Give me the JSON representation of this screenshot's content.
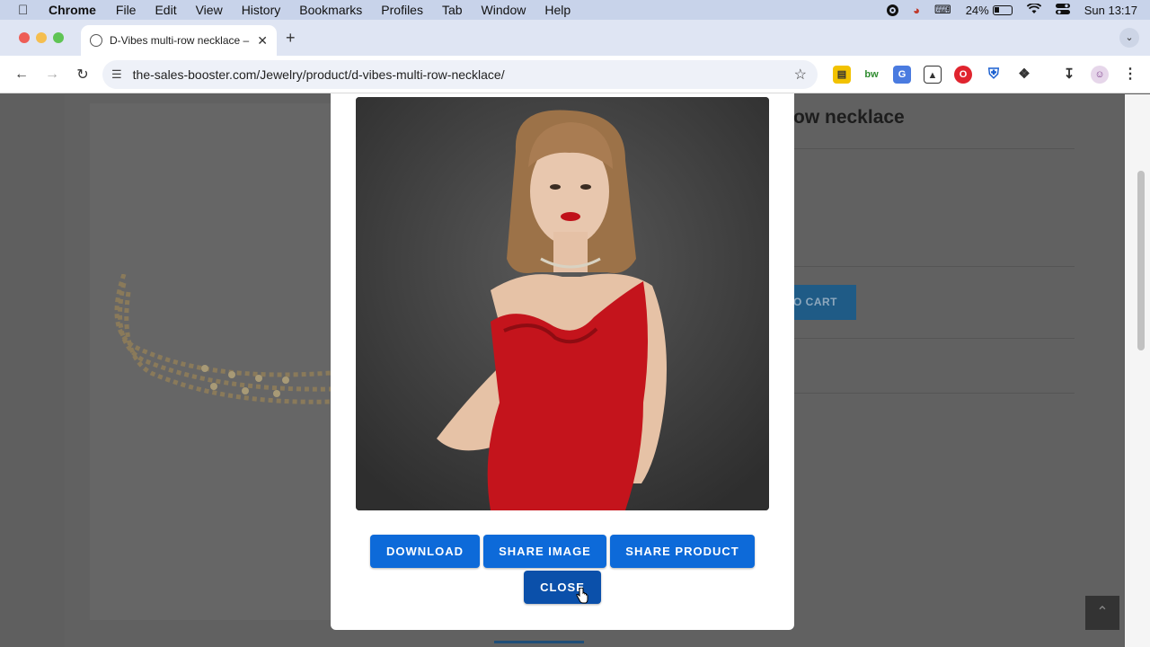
{
  "menubar": {
    "app": "Chrome",
    "items": [
      "File",
      "Edit",
      "View",
      "History",
      "Bookmarks",
      "Profiles",
      "Tab",
      "Window",
      "Help"
    ],
    "battery": "24%",
    "clock": "Sun 13:17"
  },
  "tab": {
    "title": "D-Vibes multi-row necklace –"
  },
  "toolbar": {
    "url": "the-sales-booster.com/Jewelry/product/d-vibes-multi-row-necklace/"
  },
  "page": {
    "product_title_fragment": "ow necklace",
    "cart_button_fragment": "O CART"
  },
  "modal": {
    "buttons": {
      "download": "DOWNLOAD",
      "share_image": "SHARE IMAGE",
      "share_product": "SHARE PRODUCT",
      "close": "CLOSE"
    }
  },
  "colors": {
    "primary_button": "#0d6ad9",
    "close_button": "#0b50aa",
    "overlay": "#5f5f5f"
  }
}
